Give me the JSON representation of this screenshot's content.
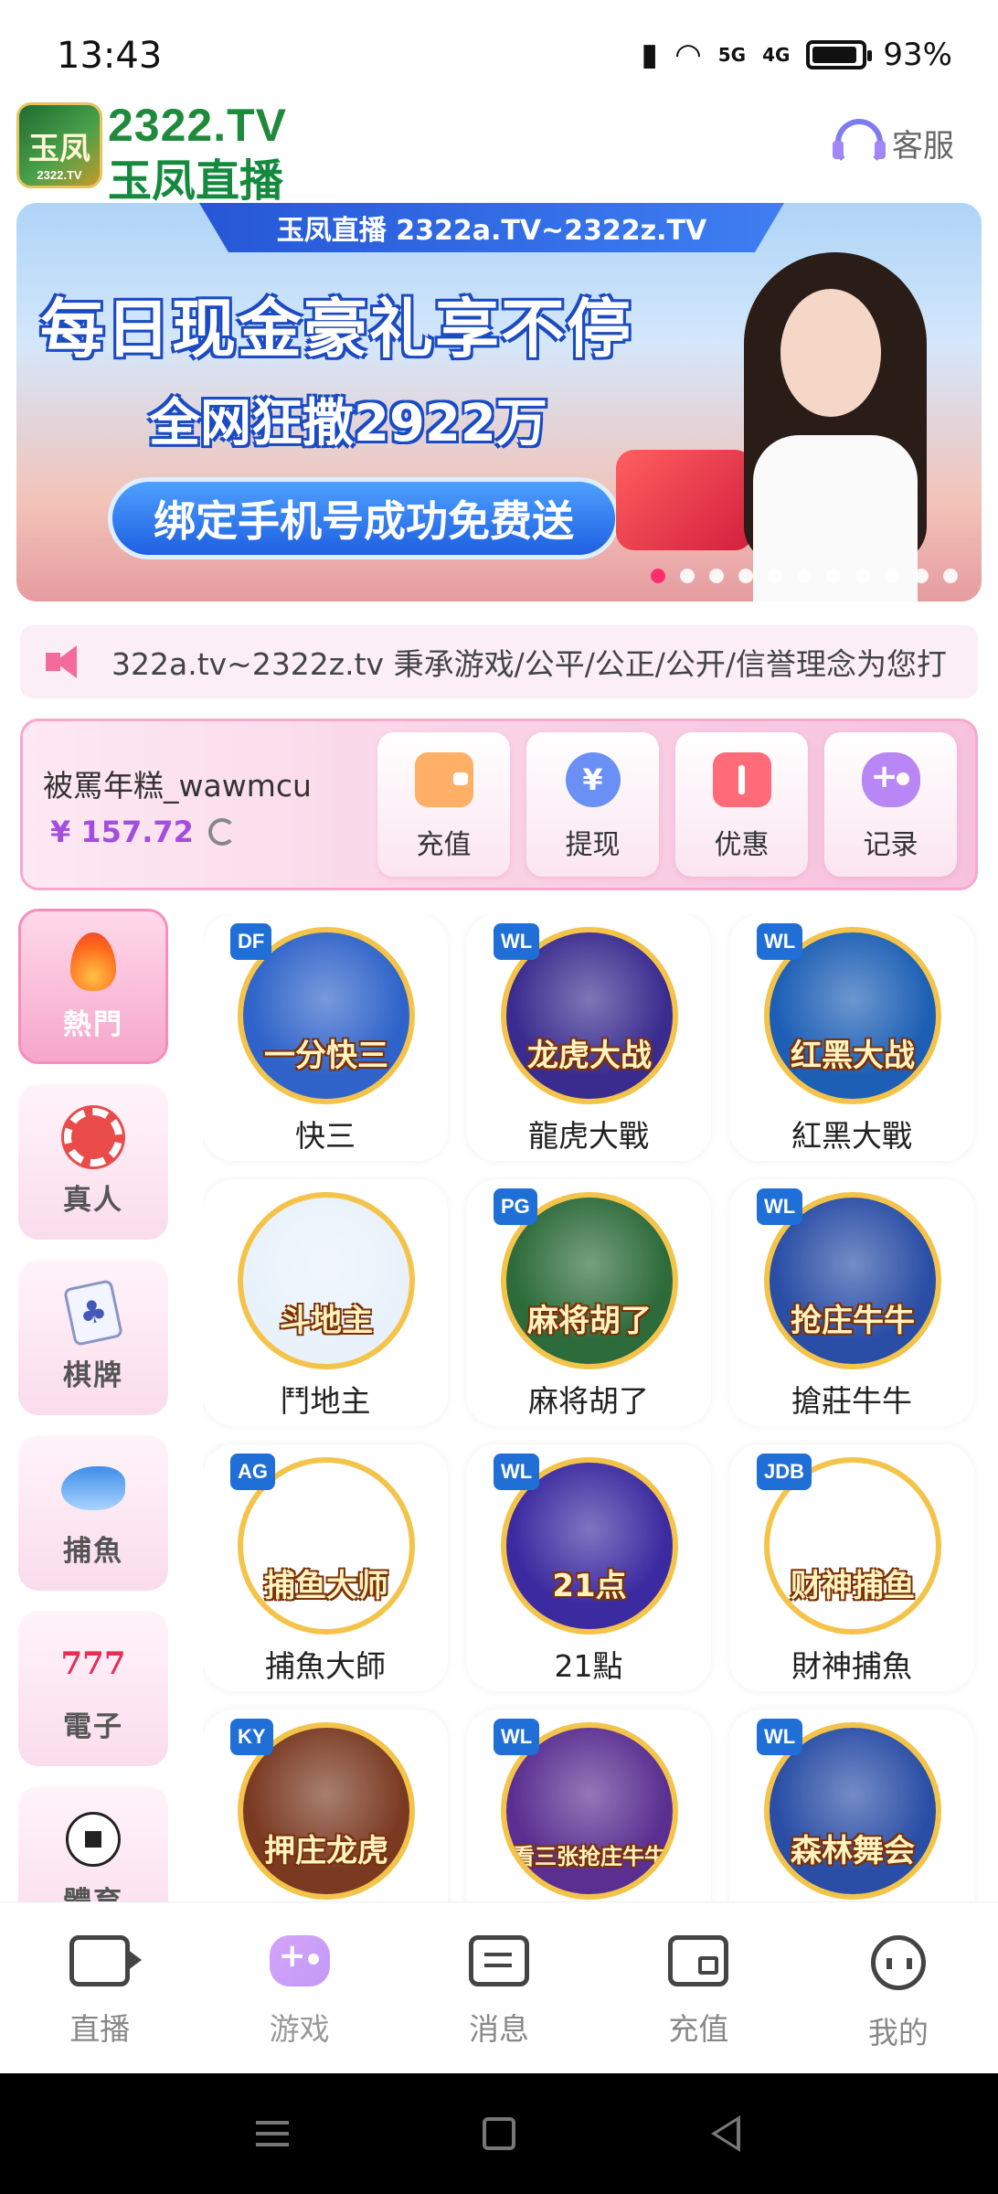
{
  "status_bar": {
    "time": "13:43",
    "signal_5g": "5G",
    "signal_4g": "4G",
    "battery": "93%",
    "battery_level": 0.93
  },
  "header": {
    "logo_line1": "2322.TV",
    "logo_line2": "玉凤直播",
    "logo_badge": "玉凤",
    "logo_badge_small": "2322.TV",
    "support_label": "客服"
  },
  "banner": {
    "tag": "玉凤直播 2322a.TV~2322z.TV",
    "headline": "每日现金豪礼享不停",
    "subheadline": "全网狂撒2922万",
    "button": "绑定手机号成功免费送",
    "slide_count": 11,
    "active_slide": 1
  },
  "marquee": {
    "text": "322a.tv~2322z.tv 秉承游戏/公平/公正/公开/信誉理念为您打"
  },
  "account": {
    "username": "被罵年糕_wawmcu",
    "balance": "¥ 157.72",
    "actions": [
      {
        "label": "充值",
        "icon": "wallet-icon"
      },
      {
        "label": "提现",
        "icon": "yuan-icon"
      },
      {
        "label": "优惠",
        "icon": "ticket-icon"
      },
      {
        "label": "记录",
        "icon": "gamepad-icon"
      }
    ]
  },
  "categories": [
    {
      "label": "熱門",
      "icon": "flame-icon",
      "active": true
    },
    {
      "label": "真人",
      "icon": "chip-icon",
      "active": false
    },
    {
      "label": "棋牌",
      "icon": "cards-icon",
      "active": false
    },
    {
      "label": "捕魚",
      "icon": "shark-icon",
      "active": false
    },
    {
      "label": "電子",
      "icon": "slot-777-icon",
      "active": false
    },
    {
      "label": "體育",
      "icon": "soccer-ball-icon",
      "active": false
    }
  ],
  "category_glyphs": {
    "cards": "♣",
    "slot": "777"
  },
  "games": [
    {
      "name": "快三",
      "art_title": "一分快三",
      "provider": "DF",
      "bg": "#2f63c9"
    },
    {
      "name": "龍虎大戰",
      "art_title": "龙虎大战",
      "provider": "WL",
      "bg": "#3a2c8f"
    },
    {
      "name": "紅黑大戰",
      "art_title": "红黑大战",
      "provider": "WL",
      "bg": "#1d5fb5"
    },
    {
      "name": "鬥地主",
      "art_title": "斗地主",
      "provider": "",
      "bg": "#e9f2fb"
    },
    {
      "name": "麻将胡了",
      "art_title": "麻将胡了",
      "provider": "PG",
      "bg": "#2d6b3a"
    },
    {
      "name": "搶莊牛牛",
      "art_title": "抢庄牛牛",
      "provider": "WL",
      "bg": "#2a4ea6"
    },
    {
      "name": "捕魚大師",
      "art_title": "捕鱼大师",
      "provider": "AG",
      "bg": "#ffffff"
    },
    {
      "name": "21點",
      "art_title": "21点",
      "provider": "WL",
      "bg": "#3b2aa0"
    },
    {
      "name": "財神捕魚",
      "art_title": "财神捕鱼",
      "provider": "JDB",
      "bg": "#ffffff"
    },
    {
      "name": "",
      "art_title": "押庄龙虎",
      "provider": "KY",
      "bg": "#7a3a22"
    },
    {
      "name": "",
      "art_title": "看三张抢庄牛牛",
      "provider": "WL",
      "bg": "#5a2f91"
    },
    {
      "name": "",
      "art_title": "森林舞会",
      "provider": "WL",
      "bg": "#2a4ea6"
    }
  ],
  "tabs": [
    {
      "label": "直播",
      "icon": "live-camera-icon",
      "active": false
    },
    {
      "label": "游戏",
      "icon": "gamepad-icon",
      "active": true
    },
    {
      "label": "消息",
      "icon": "message-icon",
      "active": false
    },
    {
      "label": "充值",
      "icon": "wallet-icon",
      "active": false
    },
    {
      "label": "我的",
      "icon": "profile-icon",
      "active": false
    }
  ],
  "colors": {
    "accent_pink": "#f78dbd",
    "balance_purple": "#a44ee0",
    "brand_green": "#1f8a3c",
    "active_dot": "#ff2e6a"
  }
}
